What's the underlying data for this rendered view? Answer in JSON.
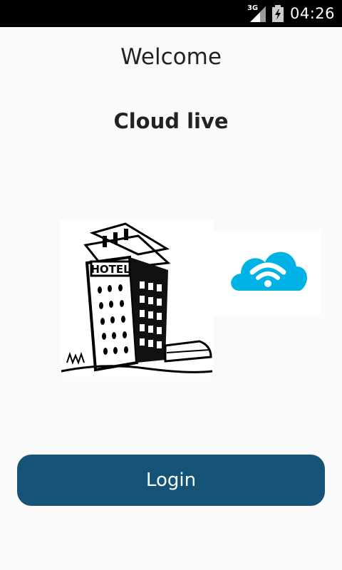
{
  "status_bar": {
    "network_type": "3G",
    "time": "04:26",
    "signal_icon": "cell-signal-icon",
    "battery_icon": "battery-charging-icon"
  },
  "main": {
    "welcome_text": "Welcome",
    "app_title": "Cloud live",
    "hotel_image": "hotel-building-illustration",
    "cloud_image": "cloud-wifi-icon",
    "login_label": "Login"
  },
  "colors": {
    "background": "#fafafa",
    "button": "#155377",
    "cloud": "#00b3e6"
  }
}
